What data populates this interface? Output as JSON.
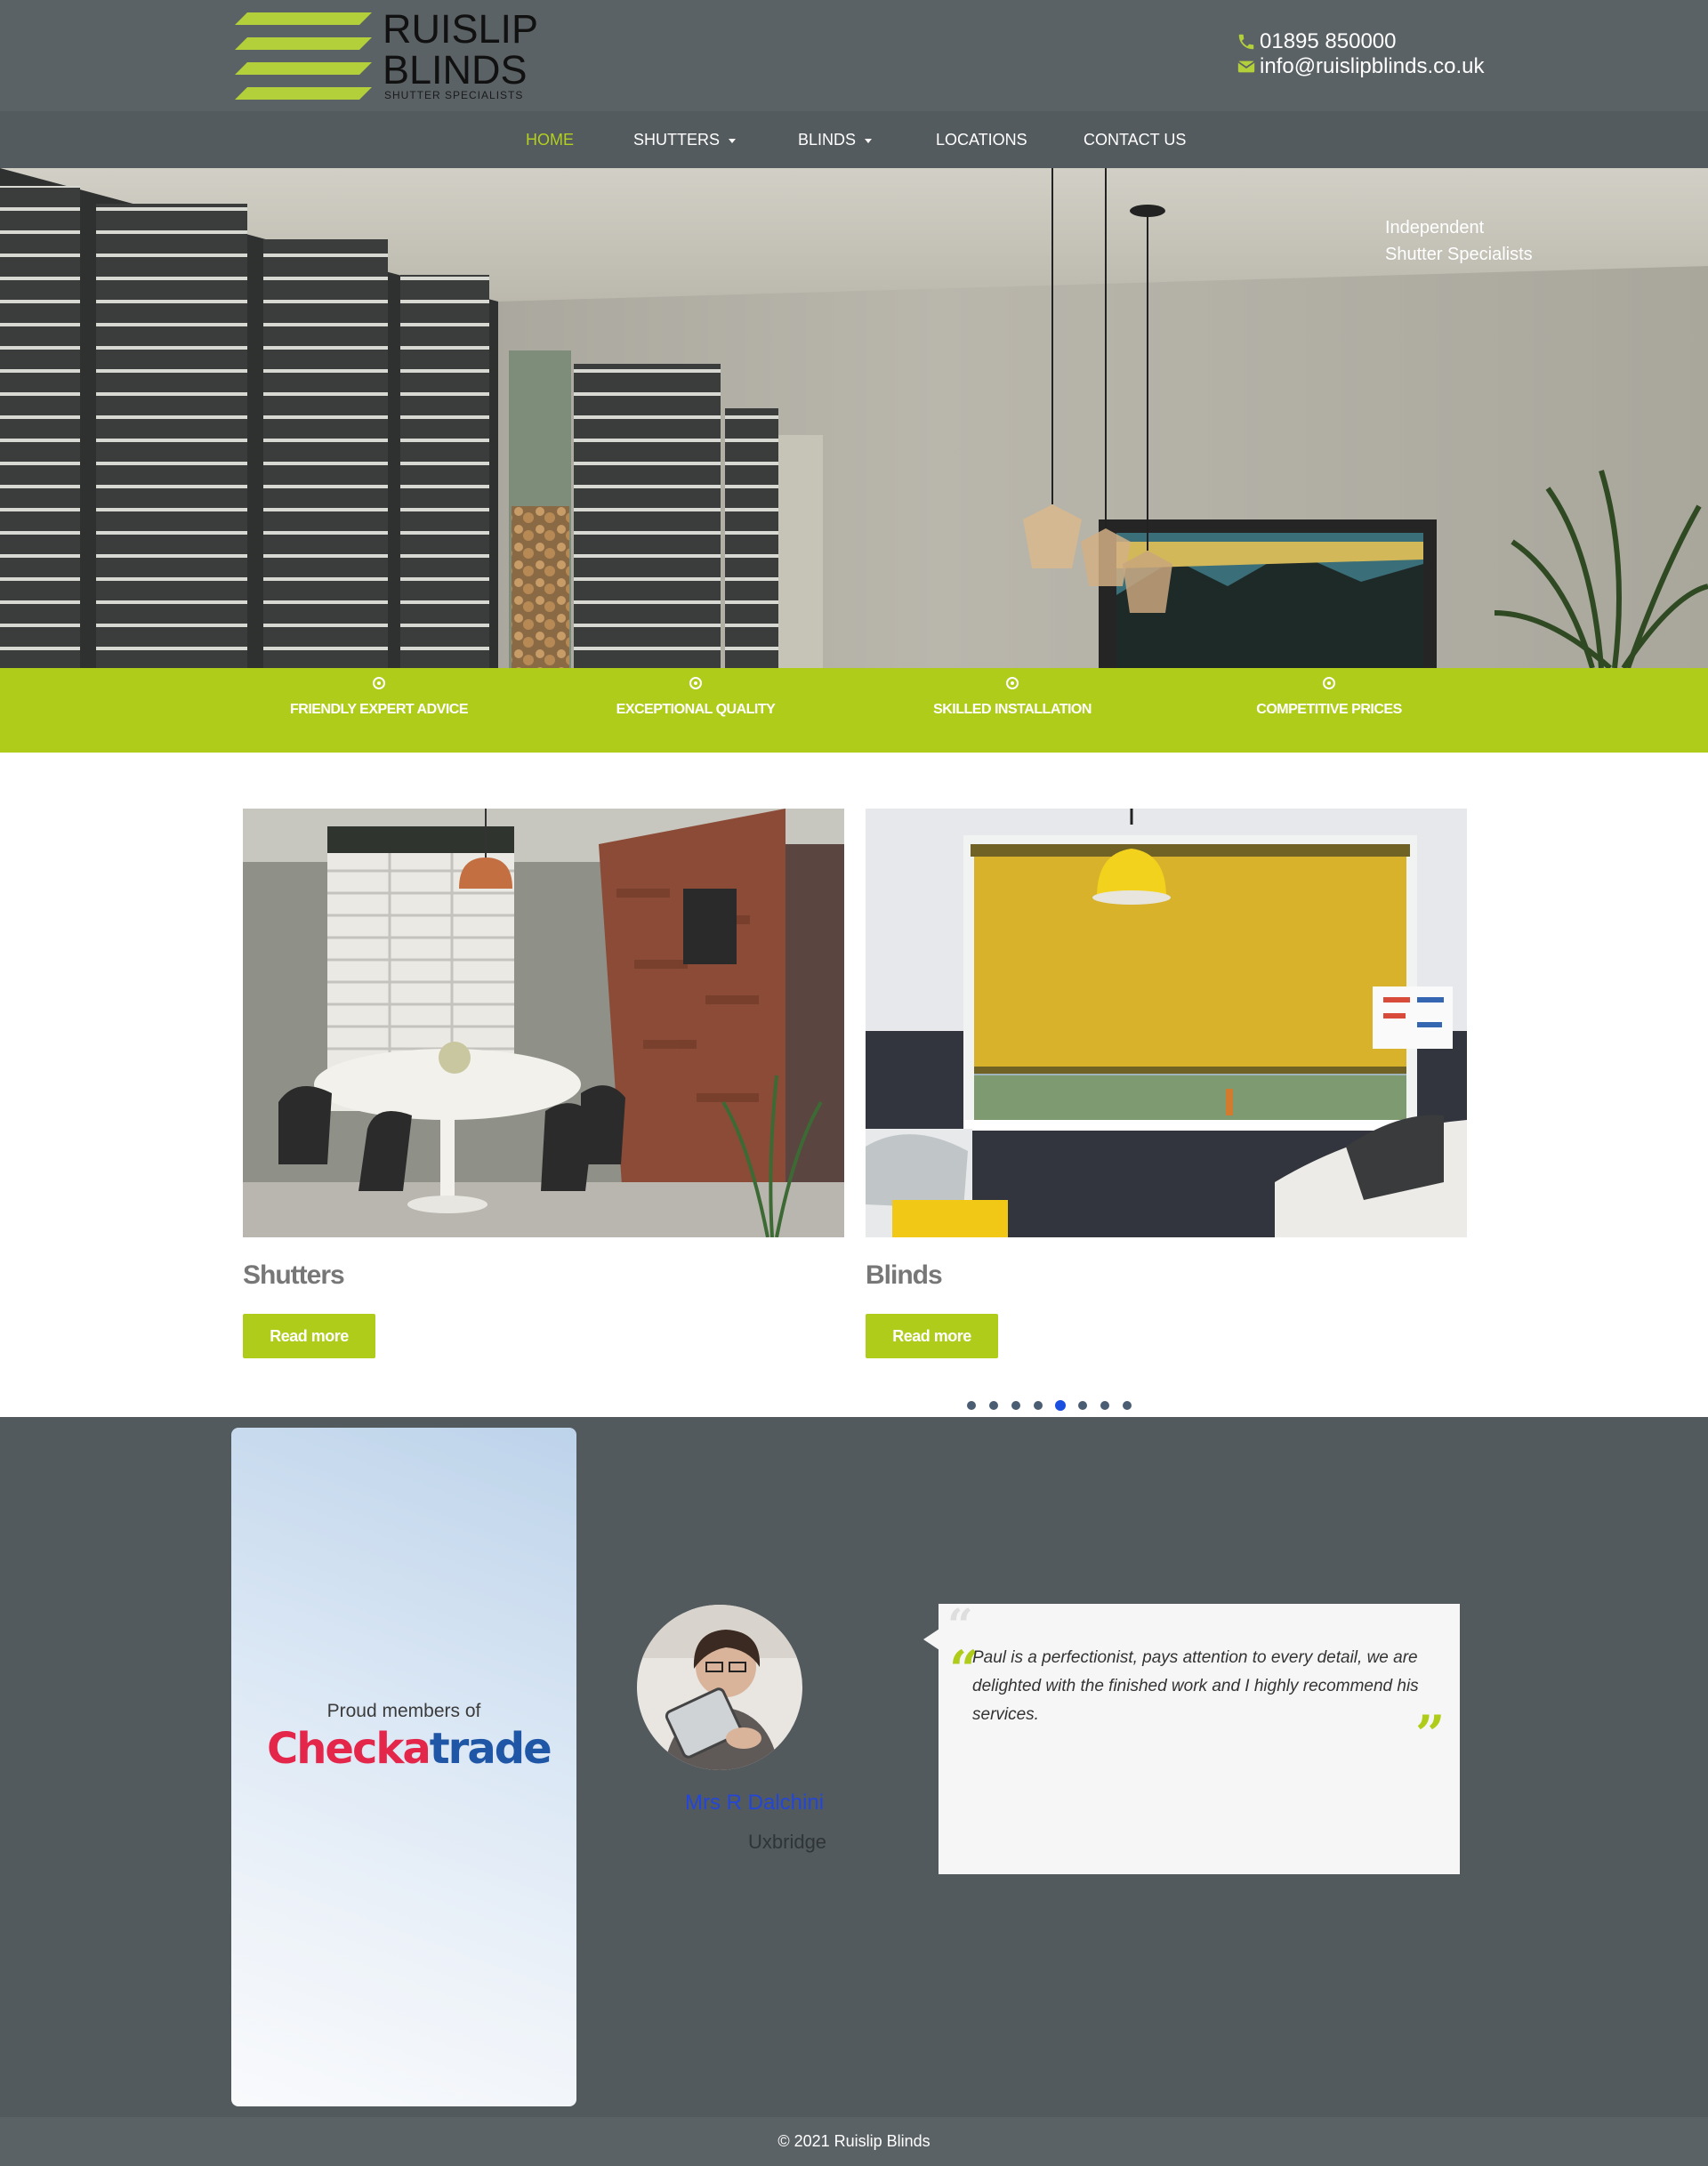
{
  "header": {
    "logo": {
      "name_line1": "RUISLIP",
      "name_line2": "BLINDS",
      "tagline": "SHUTTER SPECIALISTS"
    },
    "phone": "01895 850000",
    "email": "info@ruislipblinds.co.uk",
    "icons": {
      "phone": "phone-icon",
      "email": "envelope-icon"
    },
    "brand_color": "#afcc1a",
    "bar_color": "#5b6265"
  },
  "nav": {
    "items": [
      {
        "label": "HOME",
        "active": true
      },
      {
        "label": "SHUTTERS",
        "has_dropdown": true
      },
      {
        "label": "BLINDS",
        "has_dropdown": true
      },
      {
        "label": "LOCATIONS"
      },
      {
        "label": "CONTACT US"
      }
    ],
    "active_color": "#afcc1a"
  },
  "hero": {
    "tagline_line1": "Independent",
    "tagline_line2": "Shutter Specialists"
  },
  "features": [
    {
      "label": "FRIENDLY EXPERT ADVICE",
      "icon": "circle-dot-icon"
    },
    {
      "label": "EXCEPTIONAL QUALITY",
      "icon": "circle-dot-icon"
    },
    {
      "label": "SKILLED INSTALLATION",
      "icon": "circle-dot-icon"
    },
    {
      "label": "COMPETITIVE PRICES",
      "icon": "circle-dot-icon"
    }
  ],
  "products": [
    {
      "title": "Shutters",
      "button": "Read more"
    },
    {
      "title": "Blinds",
      "button": "Read more"
    }
  ],
  "membership": {
    "intro": "Proud members of",
    "logo_part1": "Checka",
    "logo_part2": "trade"
  },
  "testimonial": {
    "name": "Mrs R Dalchini",
    "location": "Uxbridge",
    "quote": "Paul is a perfectionist, pays attention to every detail, we are delighted with the finished work and I highly recommend his services.",
    "slide_count": 8,
    "active_slide": 5
  },
  "footer": {
    "copyright": "© 2021 Ruislip Blinds"
  }
}
